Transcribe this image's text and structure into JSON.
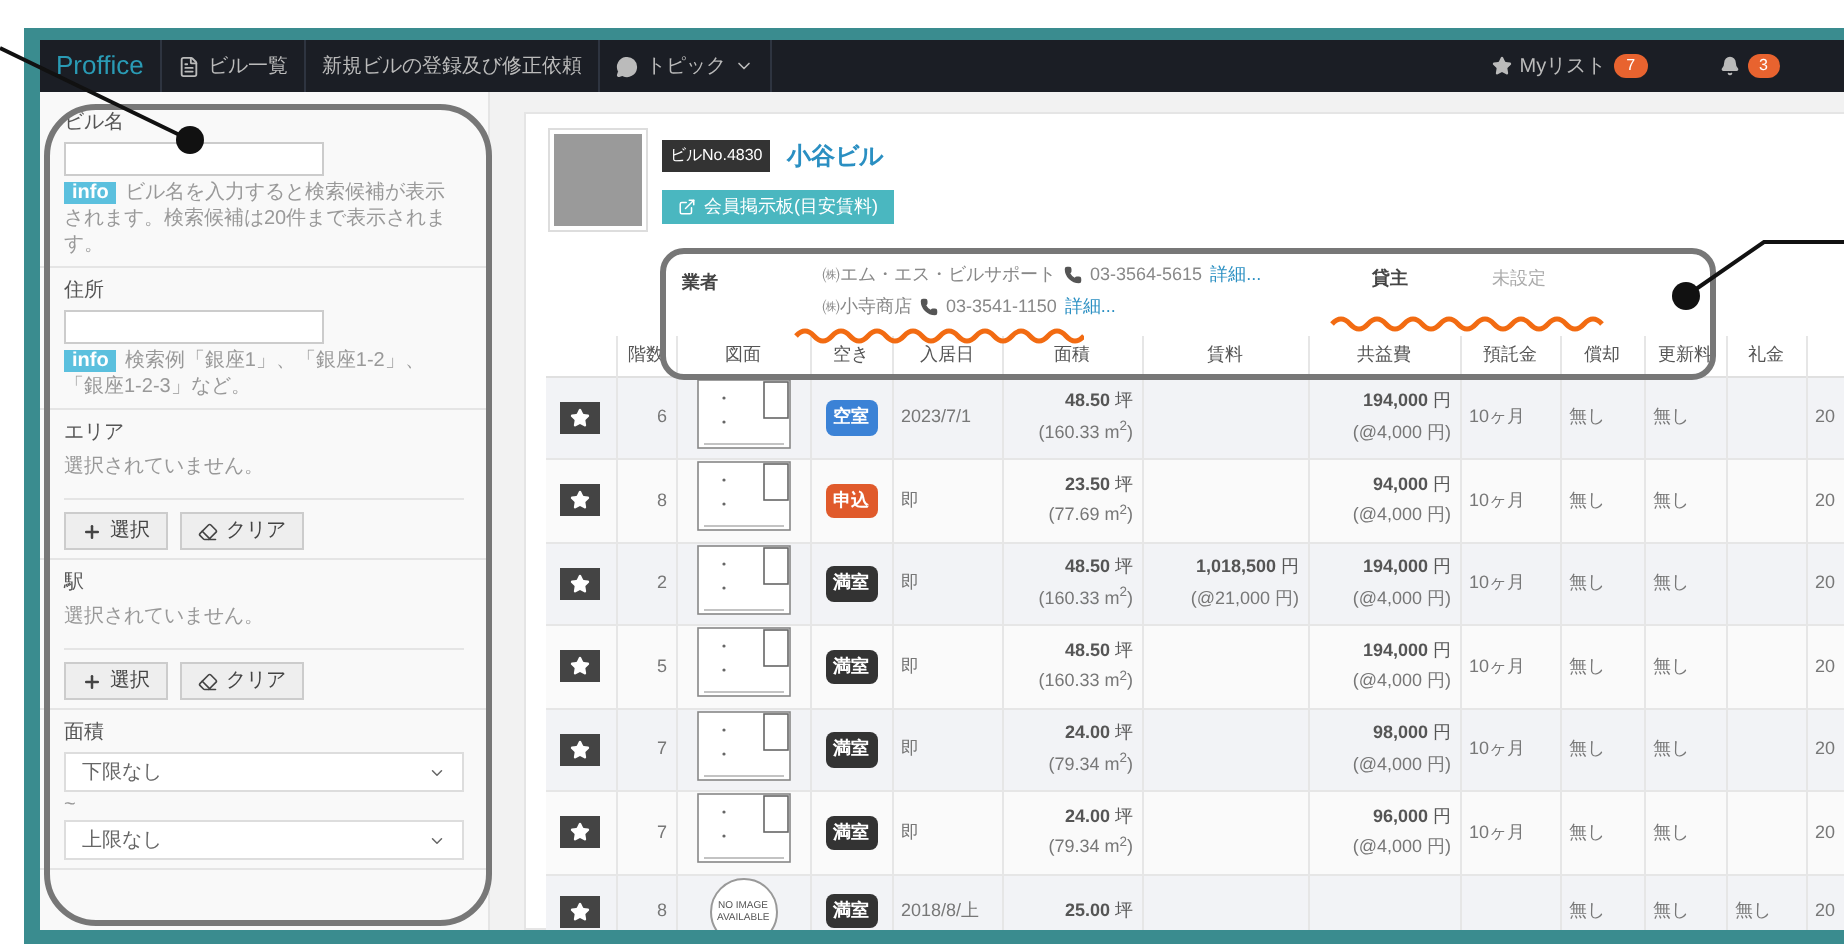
{
  "nav": {
    "brand": "Proffice",
    "items": [
      {
        "kind": "list",
        "label": "ビル一覧"
      },
      {
        "kind": "plain",
        "label": "新規ビルの登録及び修正依頼"
      },
      {
        "kind": "menu",
        "label": "トピック"
      }
    ],
    "mylist": {
      "label": "Myリスト",
      "count": "7"
    },
    "notifications": {
      "count": "3"
    }
  },
  "sidebar": [
    {
      "kind": "text",
      "label": "ビル名",
      "badge": "info",
      "hint": "ビル名を入力すると検索候補が表示されます。検索候補は20件まで表示されます。"
    },
    {
      "kind": "text",
      "label": "住所",
      "badge": "info",
      "hint": "検索例「銀座1」、「銀座1-2」、「銀座1-2-3」など。"
    },
    {
      "kind": "picker",
      "label": "エリア",
      "value": "選択されていません。",
      "buttons": [
        {
          "kind": "add",
          "label": "選択"
        },
        {
          "kind": "clear",
          "label": "クリア"
        }
      ]
    },
    {
      "kind": "picker",
      "label": "駅",
      "value": "選択されていません。",
      "buttons": [
        {
          "kind": "add",
          "label": "選択"
        },
        {
          "kind": "clear",
          "label": "クリア"
        }
      ]
    },
    {
      "kind": "range",
      "label": "面積",
      "min": "下限なし",
      "separator": "~",
      "max": "上限なし"
    }
  ],
  "building": {
    "number": "ビルNo.4830",
    "name": "小谷ビル",
    "board_button": "会員掲示板(目安賃料)",
    "agents_label": "業者",
    "agents": [
      {
        "name": "㈱エム・エス・ビルサポート",
        "phone": "03-3564-5615",
        "link": "詳細..."
      },
      {
        "name": "㈱小寺商店",
        "phone": "03-3541-1150",
        "link": "詳細..."
      }
    ],
    "landlord_label": "貸主",
    "landlord": "未設定"
  },
  "table": {
    "columns": [
      "",
      "階数",
      "図面",
      "空き",
      "入居日",
      "面積",
      "賃料",
      "共益費",
      "預託金",
      "償却",
      "更新料",
      "礼金",
      ""
    ],
    "rows": [
      {
        "floor": "6",
        "plan": {
          "kind": "drawing"
        },
        "status": {
          "kind": "vacant",
          "label": "空室"
        },
        "move_in": "2023/7/1",
        "area": "**48.50** 坪",
        "area_m2": "(160.33 m$^{2}$)",
        "rent": "",
        "rent_unit": "",
        "common": "**194,000** 円",
        "common_unit": "(@4,000 円)",
        "deposit": "10ヶ月",
        "amortization": "無し",
        "renewal": "無し",
        "key_money": "",
        "column_13": "20"
      },
      {
        "floor": "8",
        "plan": {
          "kind": "drawing"
        },
        "status": {
          "kind": "applied",
          "label": "申込"
        },
        "move_in": "即",
        "area": "**23.50** 坪",
        "area_m2": "(77.69 m$^{2}$)",
        "rent": "",
        "rent_unit": "",
        "common": "**94,000** 円",
        "common_unit": "(@4,000 円)",
        "deposit": "10ヶ月",
        "amortization": "無し",
        "renewal": "無し",
        "key_money": "",
        "column_13": "20"
      },
      {
        "floor": "2",
        "plan": {
          "kind": "drawing"
        },
        "status": {
          "kind": "full",
          "label": "満室"
        },
        "move_in": "即",
        "area": "**48.50** 坪",
        "area_m2": "(160.33 m$^{2}$)",
        "rent": "**1,018,500** 円",
        "rent_unit": "(@21,000 円)",
        "common": "**194,000** 円",
        "common_unit": "(@4,000 円)",
        "deposit": "10ヶ月",
        "amortization": "無し",
        "renewal": "無し",
        "key_money": "",
        "column_13": "20"
      },
      {
        "floor": "5",
        "plan": {
          "kind": "drawing"
        },
        "status": {
          "kind": "full",
          "label": "満室"
        },
        "move_in": "即",
        "area": "**48.50** 坪",
        "area_m2": "(160.33 m$^{2}$)",
        "rent": "",
        "rent_unit": "",
        "common": "**194,000** 円",
        "common_unit": "(@4,000 円)",
        "deposit": "10ヶ月",
        "amortization": "無し",
        "renewal": "無し",
        "key_money": "",
        "column_13": "20"
      },
      {
        "floor": "7",
        "plan": {
          "kind": "drawing"
        },
        "status": {
          "kind": "full",
          "label": "満室"
        },
        "move_in": "即",
        "area": "**24.00** 坪",
        "area_m2": "(79.34 m$^{2}$)",
        "rent": "",
        "rent_unit": "",
        "common": "**98,000** 円",
        "common_unit": "(@4,000 円)",
        "deposit": "10ヶ月",
        "amortization": "無し",
        "renewal": "無し",
        "key_money": "",
        "column_13": "20"
      },
      {
        "floor": "7",
        "plan": {
          "kind": "drawing"
        },
        "status": {
          "kind": "full",
          "label": "満室"
        },
        "move_in": "即",
        "area": "**24.00** 坪",
        "area_m2": "(79.34 m$^{2}$)",
        "rent": "",
        "rent_unit": "",
        "common": "**96,000** 円",
        "common_unit": "(@4,000 円)",
        "deposit": "10ヶ月",
        "amortization": "無し",
        "renewal": "無し",
        "key_money": "",
        "column_13": "20"
      },
      {
        "floor": "8",
        "plan": {
          "kind": "none",
          "text": "NO IMAGE AVAILABLE"
        },
        "status": {
          "kind": "full",
          "label": "満室"
        },
        "move_in": "2018/8/上",
        "area": "**25.00** 坪",
        "area_m2": "",
        "rent": "",
        "rent_unit": "",
        "common": "",
        "common_unit": "",
        "deposit": "",
        "amortization": "無し",
        "renewal": "無し",
        "key_money": "無し",
        "column_13": "20"
      }
    ]
  }
}
